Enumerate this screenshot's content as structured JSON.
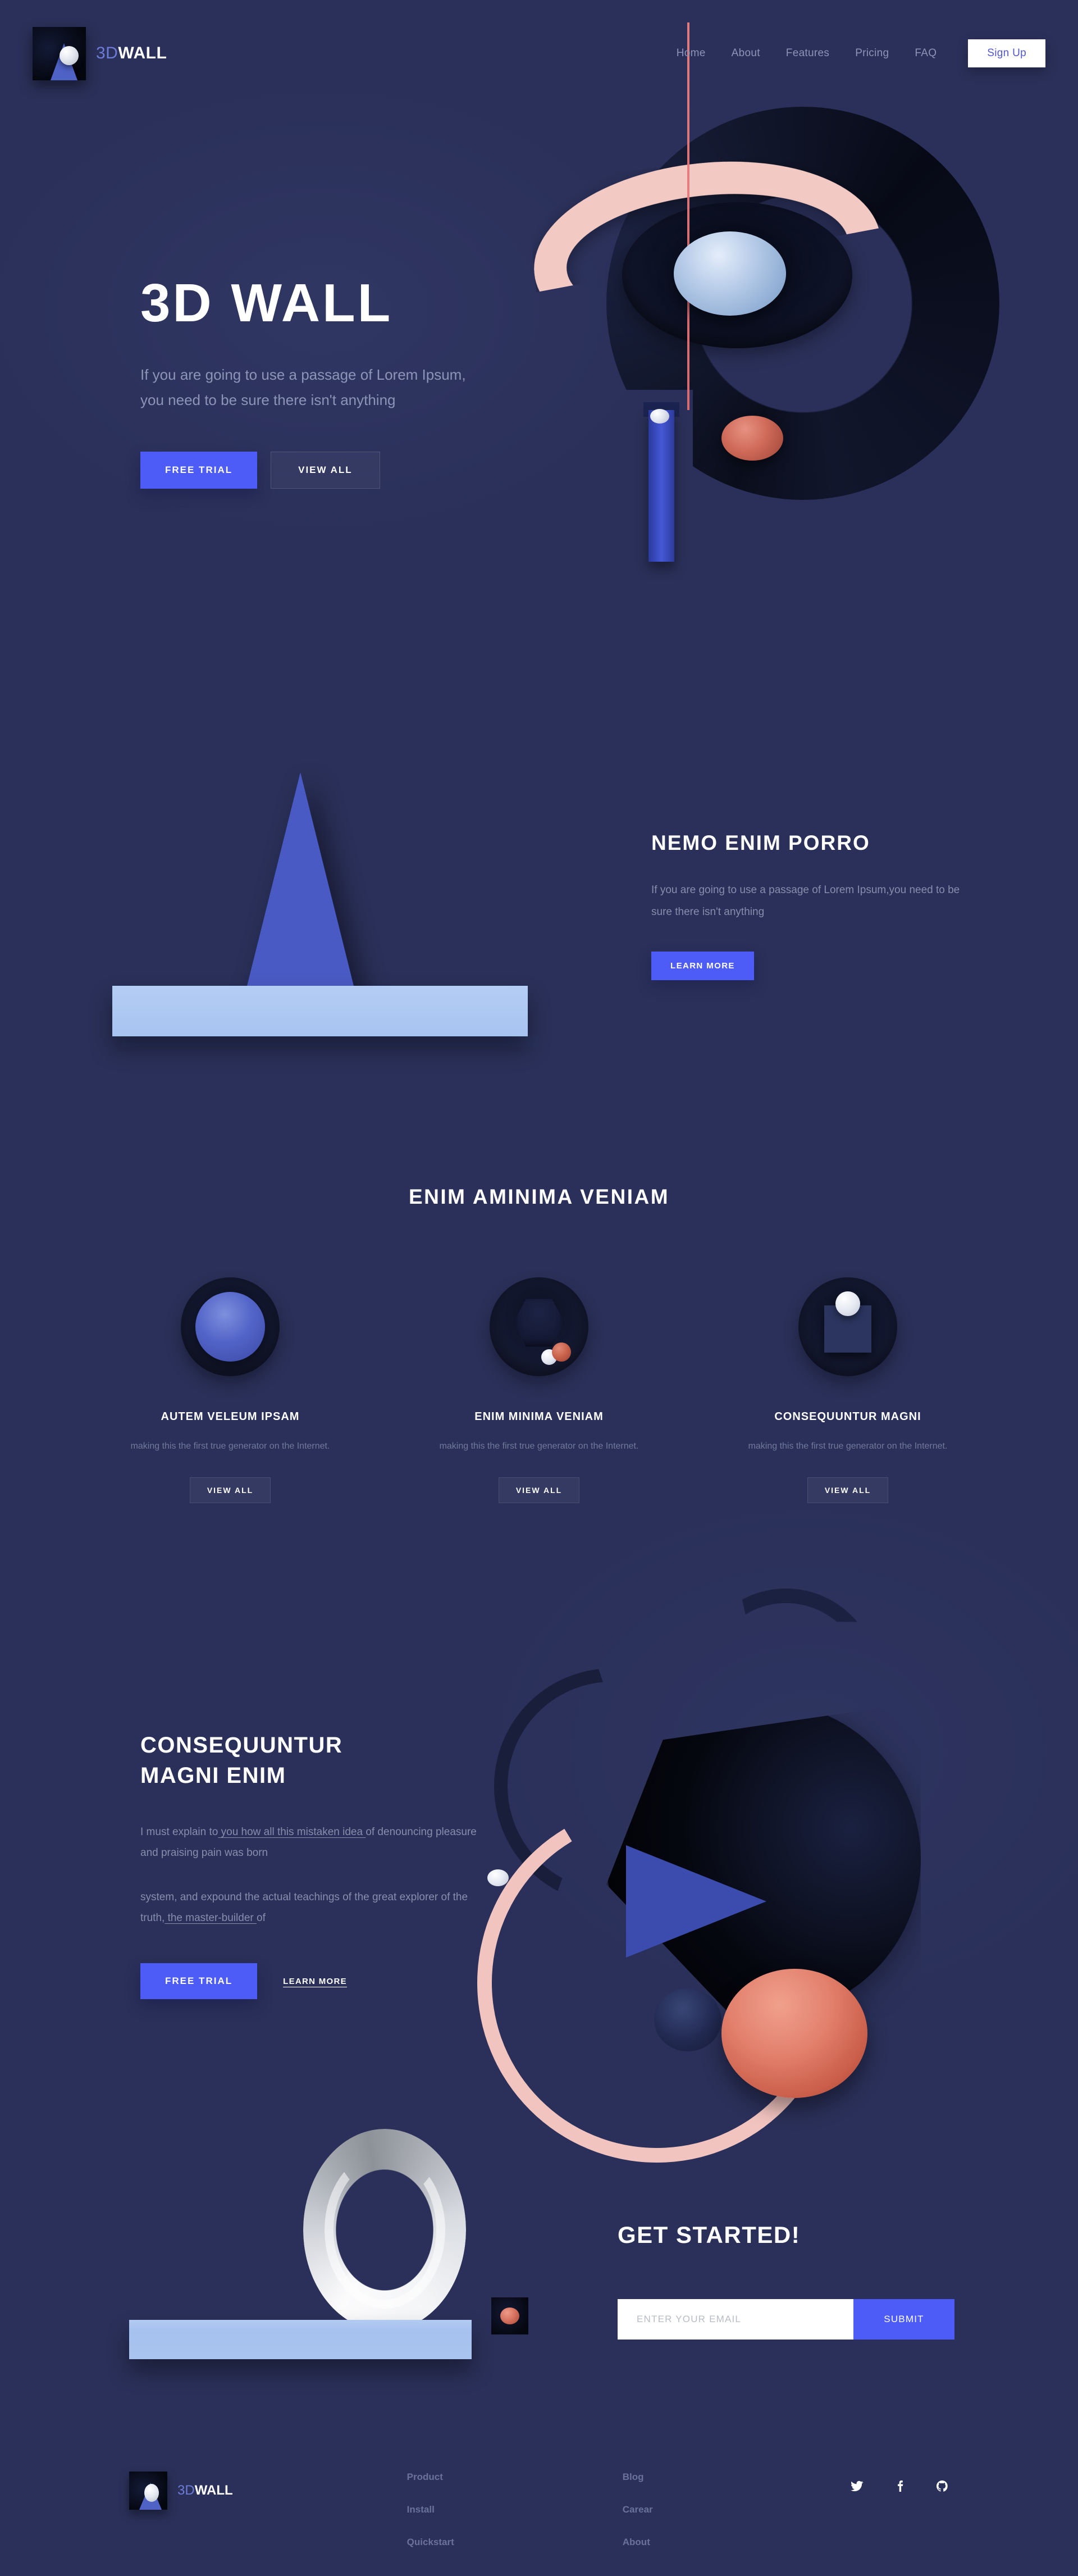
{
  "brand": {
    "light": "3D",
    "heavy": "WALL"
  },
  "nav": {
    "items": [
      {
        "label": "Home"
      },
      {
        "label": "About"
      },
      {
        "label": "Features"
      },
      {
        "label": "Pricing"
      },
      {
        "label": "FAQ"
      }
    ],
    "signup_label": "Sign Up"
  },
  "hero": {
    "title": "3D WALL",
    "subtitle": "If you are going to use a passage of Lorem Ipsum, you need to be sure there isn't anything",
    "primary_btn": "FREE TRIAL",
    "secondary_btn": "VIEW ALL"
  },
  "section_nemo": {
    "title": "NEMO ENIM PORRO",
    "body": "If you are going to use a passage of Lorem Ipsum,you need to be sure there isn't anything",
    "cta": "LEARN MORE"
  },
  "features": {
    "title": "ENIM AMINIMA VENIAM",
    "cards": [
      {
        "title": "AUTEM VELEUM IPSAM",
        "body": "making this the first true generator on the Internet.",
        "cta": "VIEW ALL"
      },
      {
        "title": "ENIM MINIMA VENIAM",
        "body": "making this the first true generator on the Internet.",
        "cta": "VIEW ALL"
      },
      {
        "title": "CONSEQUUNTUR MAGNI",
        "body": "making this the first true generator on the Internet.",
        "cta": "VIEW ALL"
      }
    ]
  },
  "section_consequuntur": {
    "title_line1": "CONSEQUUNTUR",
    "title_line2": "MAGNI ENIM",
    "para1_pre": "I must explain to",
    "para1_link": " you how all this mistaken idea ",
    "para1_post": "of denouncing pleasure and praising pain was born",
    "para2_pre": "system, and expound the actual teachings of the great explorer of the truth,",
    "para2_link": " the master-builder ",
    "para2_post": "of",
    "primary_btn": "FREE TRIAL",
    "secondary_btn": "LEARN MORE"
  },
  "get_started": {
    "title": "GET STARTED!",
    "email_placeholder": "ENTER YOUR EMAIL",
    "email_value": "",
    "submit_label": "SUBMIT"
  },
  "footer": {
    "col1": [
      {
        "label": "Product"
      },
      {
        "label": "Install"
      },
      {
        "label": "Quickstart"
      }
    ],
    "col2": [
      {
        "label": "Blog"
      },
      {
        "label": "Carear"
      },
      {
        "label": "About"
      }
    ],
    "socials": [
      {
        "name": "twitter"
      },
      {
        "name": "facebook"
      },
      {
        "name": "github"
      }
    ]
  },
  "colors": {
    "background": "#2a3059",
    "accent_blue": "#4d5cf6",
    "brand_light": "#6d7cd6",
    "pink_arc": "#f2c4c0",
    "red_sphere": "#d4705c",
    "platform_blue": "#a6c1ee",
    "muted_text": "#868ead"
  }
}
